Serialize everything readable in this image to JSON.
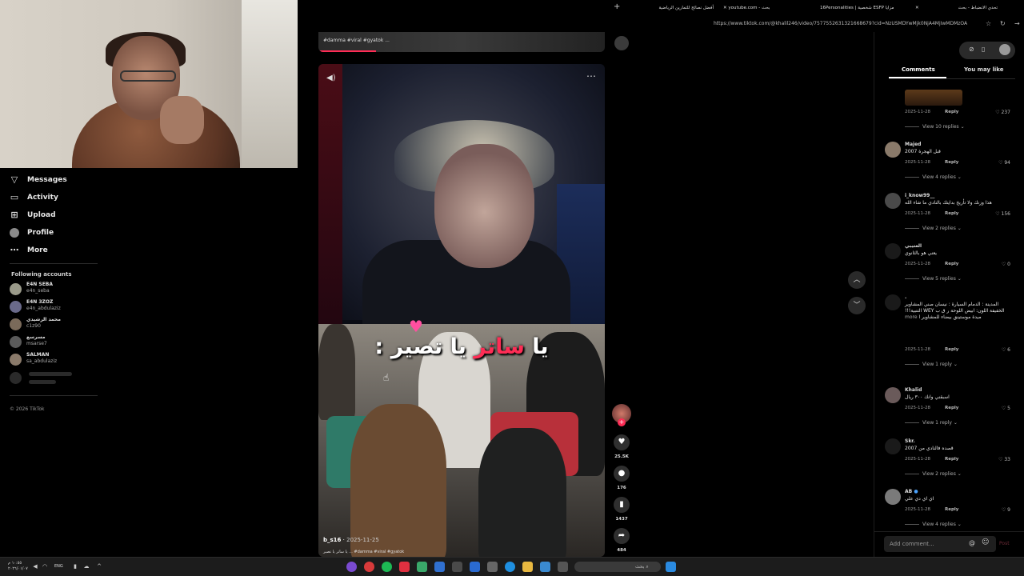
{
  "browser": {
    "tabs": [
      {
        "label": "أفضل نصائح للتمارين الرياضية"
      },
      {
        "label": "youtube.com - بحث"
      },
      {
        "label": "16Personalities | شخصية ESFP مزايا"
      },
      {
        "label": "تحدي الانضباط - بحث"
      }
    ],
    "url": "https://www.tiktok.com/@khalil246/video/7577552631321668679?cid=NzUSMDYwMjk0NjA4MjIwMDMzOA"
  },
  "sidebar": {
    "items": [
      {
        "label": "Messages",
        "icon": "paper-plane-icon"
      },
      {
        "label": "Activity",
        "icon": "bell-icon"
      },
      {
        "label": "Upload",
        "icon": "plus-square-icon"
      },
      {
        "label": "Profile",
        "icon": "profile-avatar-icon"
      },
      {
        "label": "More",
        "icon": "more-dots-icon"
      }
    ],
    "following_title": "Following accounts",
    "following": [
      {
        "name": "E4N SEBA",
        "handle": "e4n_seba"
      },
      {
        "name": "E4N 3ZOZ",
        "handle": "e4n_abdulaziz"
      },
      {
        "name": "محمد الرشيدي",
        "handle": "c1z90"
      },
      {
        "name": "مسرسع",
        "handle": "msarse7"
      },
      {
        "name": "SALMAN",
        "handle": "sa_abdulaziz"
      }
    ],
    "copyright": "© 2026 TikTok"
  },
  "video": {
    "prev_caption": "#damma #viral #gyatok ...",
    "overlay_text_1": "يا ",
    "overlay_text_red": "ساتر",
    "overlay_text_2": " يا تصير :",
    "author": "b_s16",
    "date": "2025-11-25",
    "description": "يا ساتر يا تصير ... #damma #viral #gyatok",
    "likes": "25.5K",
    "comments_count": "176",
    "saves": "1437",
    "shares": "484"
  },
  "panel": {
    "tab_comments": "Comments",
    "tab_you_may_like": "You may like",
    "comments": [
      {
        "user": "",
        "text": "",
        "date": "2025-11-28",
        "reply": "Reply",
        "likes": "237",
        "view_replies": "View 10 replies"
      },
      {
        "user": "Majed",
        "text": "قبل الهجرة 2007",
        "date": "2025-11-28",
        "reply": "Reply",
        "likes": "94",
        "view_replies": "View 4 replies"
      },
      {
        "user": "i_know99__",
        "text": "هذا وزنك ولا تأريخ بدايتك بالنادي ما شاء الله",
        "date": "2025-11-28",
        "reply": "Reply",
        "likes": "156",
        "view_replies": "View 2 replies"
      },
      {
        "user": "العتيبي",
        "text": "يعني هو بالثانوي",
        "date": "2025-11-28",
        "reply": "Reply",
        "likes": "0",
        "view_replies": "View 5 replies"
      },
      {
        "user": ".",
        "text": "المدينة : الدمام ‏السيارة : نيسان صني المشاوير الخفيفة اللون: ابيض اللوحة ر ق ب WEY التنبية!!! ميدة موستينق بيضاء للمشاوير ا",
        "more": "more",
        "date": "2025-11-28",
        "reply": "Reply",
        "likes": "6",
        "view_replies": "View 1 reply"
      },
      {
        "user": "Khalid",
        "text": "اسبقني وانك ٣٠٠ ريال",
        "date": "2025-11-28",
        "reply": "Reply",
        "likes": "5",
        "view_replies": "View 1 reply"
      },
      {
        "user": "Skr.",
        "text": "قصده فالنادي من 2007",
        "date": "2025-11-28",
        "reply": "Reply",
        "likes": "33",
        "view_replies": "View 2 replies"
      },
      {
        "user": "AB",
        "text": "اي اي دي علي",
        "date": "2025-11-28",
        "reply": "Reply",
        "likes": "9",
        "view_replies": "View 4 replies"
      }
    ],
    "add_comment_placeholder": "Add comment...",
    "post_label": "Post"
  },
  "taskbar": {
    "time": "١٠:٥٥ م",
    "date": "٢٠٢٦/٠١/٠٧",
    "lang": "ENG",
    "search_label": "بحث"
  },
  "colors": {
    "accent": "#fe2c55",
    "background": "#000000"
  }
}
